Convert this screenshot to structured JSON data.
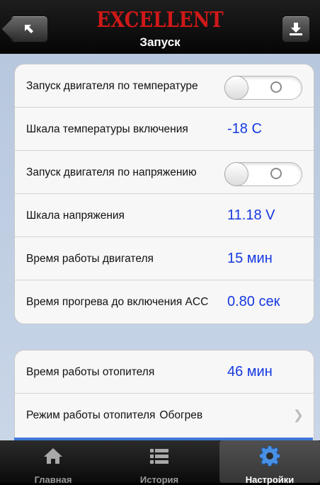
{
  "header": {
    "logo_text": "EXCELLENT",
    "title": "Запуск",
    "back_icon": "back-arrow-icon",
    "download_icon": "download-icon"
  },
  "settings_group_1": {
    "rows": [
      {
        "label": "Запуск двигателя по температуре",
        "toggle_on": false
      },
      {
        "label": "Шкала температуры включения",
        "value": "-18 C"
      },
      {
        "label": "Запуск двигателя по напряжению",
        "toggle_on": false
      },
      {
        "label": "Шкала напряжения",
        "value": "11.18 V"
      },
      {
        "label": "Время работы двигателя",
        "value": "15 мин"
      },
      {
        "label": "Время прогрева до включения ACC",
        "value": "0.80 сек"
      }
    ]
  },
  "settings_group_2": {
    "rows": [
      {
        "label": "Время работы отопителя",
        "value": "46 мин"
      },
      {
        "label": "Режим работы отопителя",
        "value": "Обогрев"
      }
    ]
  },
  "tabbar": {
    "tabs": [
      {
        "label": "Главная",
        "icon": "home-icon",
        "active": false
      },
      {
        "label": "История",
        "icon": "list-icon",
        "active": false
      },
      {
        "label": "Настройки",
        "icon": "gear-icon",
        "active": true
      }
    ]
  },
  "colors": {
    "accent_blue": "#1538e0",
    "logo_red": "#d01818",
    "background": "#c2d0e4"
  }
}
